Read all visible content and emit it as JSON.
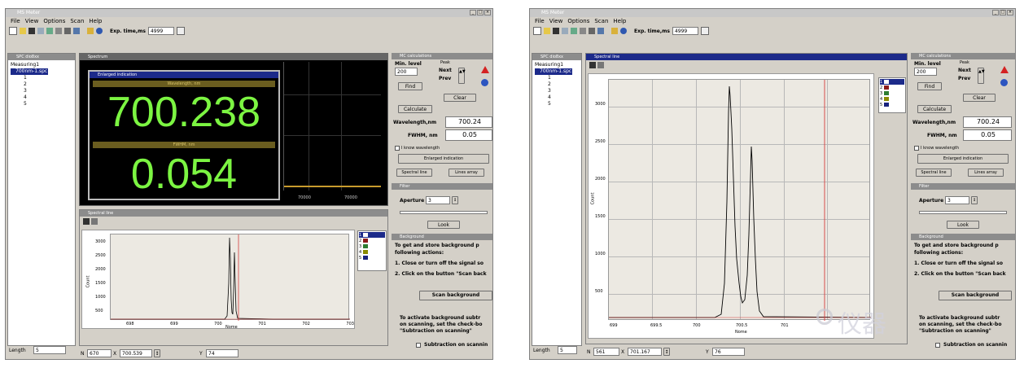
{
  "left": {
    "app_title": "MS Meter",
    "menu": [
      "File",
      "View",
      "Options",
      "Scan",
      "Help"
    ],
    "exp_time_label": "Exp. time,ms",
    "exp_time_value": "4999",
    "tree_title": "SPC dio8xx",
    "tree_items": [
      "Measuring1",
      "700nm-1.spc",
      "1",
      "2",
      "3",
      "4",
      "5"
    ],
    "length_label": "Length",
    "length_value": "5",
    "spectrum_title": "Spectrum",
    "spectrum_ticks": [
      "70000",
      "70000"
    ],
    "enlarged_title": "Enlarged indication",
    "wavelength_label": "Wavelength, nm",
    "wavelength_big": "700.238",
    "fwhm_label": "FWHM, nm",
    "fwhm_big": "0.054",
    "spectral_title": "Spectral line",
    "y_ticks": [
      "3000",
      "2500",
      "2000",
      "1500",
      "1000",
      "500"
    ],
    "x_ticks": [
      "698",
      "699",
      "700",
      "701",
      "702",
      "703"
    ],
    "x_label": "Nome",
    "y_label": "Count",
    "legend": [
      "1",
      "2",
      "3",
      "4",
      "5"
    ],
    "status": {
      "n_label": "N",
      "n": "670",
      "x_label": "X",
      "x": "700.539",
      "y_label": "Y",
      "y": "74"
    },
    "mc_title": "MC calculations",
    "min_level_label": "Min. level",
    "min_level_value": "200",
    "peak_label": "Peak",
    "next_label": "Next",
    "prev_label": "Prev",
    "find_label": "Find",
    "clear_label": "Clear",
    "calculate_label": "Calculate",
    "wl_label": "Wavelength,nm",
    "wl_value": "700.24",
    "fwhm_small_label": "FWHM, nm",
    "fwhm_small_value": "0.05",
    "known_wl_label": "I know wavelength",
    "enlarged_btn": "Enlarged indication",
    "spectral_btn": "Spectral line",
    "lines_btn": "Lines array",
    "filter_title": "Filter",
    "aperture_label": "Aperture",
    "aperture_value": "3",
    "look_label": "Look",
    "bg_title": "Background",
    "bg_text1": "To get and store background p",
    "bg_text2": "following actions:",
    "bg_step1": "1. Close or turn off the signal so",
    "bg_step2": "2. Click on the button \"Scan back",
    "scan_bg": "Scan background",
    "act_text1": "To activate background subtr",
    "act_text2": "on scanning, set the check-bo",
    "act_text3": "\"Subtraction on scanning\"",
    "subtraction_label": "Subtraction on scannin"
  },
  "right": {
    "app_title": "MS Meter",
    "menu": [
      "File",
      "View",
      "Options",
      "Scan",
      "Help"
    ],
    "exp_time_label": "Exp. time,ms",
    "exp_time_value": "4999",
    "tree_title": "SPC dio8xx",
    "tree_items": [
      "Measuring1",
      "700nm-1.spc",
      "1",
      "2",
      "3",
      "4",
      "5"
    ],
    "length_label": "Length",
    "length_value": "5",
    "spectral_title": "Spectral line",
    "y_ticks": [
      "3000",
      "2500",
      "2000",
      "1500",
      "1000",
      "500"
    ],
    "x_ticks": [
      "699",
      "699.5",
      "700",
      "700.5",
      "701"
    ],
    "x_label": "Nome",
    "y_label": "Count",
    "legend": [
      "1",
      "2",
      "3",
      "4",
      "5"
    ],
    "status": {
      "n_label": "N",
      "n": "561",
      "x_label": "X",
      "x": "701.167",
      "y_label": "Y",
      "y": "76"
    },
    "mc_title": "MC calculations",
    "min_level_label": "Min. level",
    "min_level_value": "200",
    "peak_label": "Peak",
    "next_label": "Next",
    "prev_label": "Prev",
    "find_label": "Find",
    "clear_label": "Clear",
    "calculate_label": "Calculate",
    "wl_label": "Wavelength,nm",
    "wl_value": "700.24",
    "fwhm_small_label": "FWHM, nm",
    "fwhm_small_value": "0.05",
    "known_wl_label": "I know wavelength",
    "enlarged_btn": "Enlarged indication",
    "spectral_btn": "Spectral line",
    "lines_btn": "Lines array",
    "filter_title": "Filter",
    "aperture_label": "Aperture",
    "aperture_value": "3",
    "look_label": "Look",
    "bg_title": "Background",
    "bg_text1": "To get and store background p",
    "bg_text2": "following actions:",
    "bg_step1": "1. Close or turn off the signal so",
    "bg_step2": "2. Click on the button \"Scan back",
    "scan_bg": "Scan background",
    "act_text1": "To activate background subtr",
    "act_text2": "on scanning, set the check-bo",
    "act_text3": "\"Subtraction on scanning\"",
    "subtraction_label": "Subtraction on scannin",
    "watermark": "仪器"
  },
  "colors": {
    "legend": [
      "#ffffff",
      "#8b1a1a",
      "#2e7d32",
      "#8a8a00",
      "#1a237e"
    ],
    "lcd_text": "#7cf542",
    "trace": "#000000",
    "marker": "#d43c3c"
  }
}
